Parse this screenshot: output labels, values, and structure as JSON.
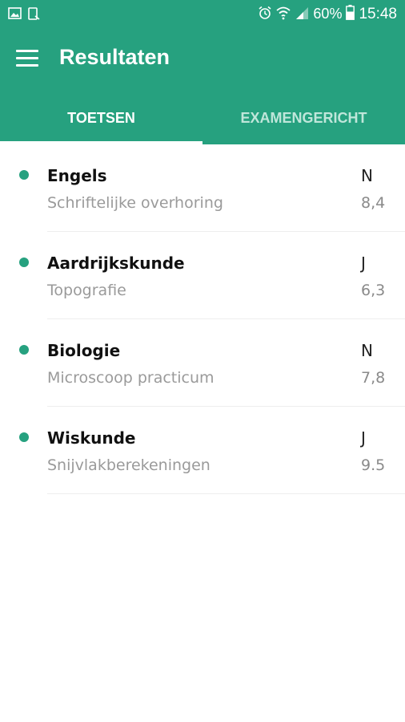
{
  "status_bar": {
    "left_icons": [
      "image-icon",
      "phone-outline-icon"
    ],
    "right_icons": [
      "alarm-icon",
      "wifi-icon",
      "signal-icon",
      "battery-icon"
    ],
    "battery_percent": "60%",
    "time": "15:48"
  },
  "toolbar": {
    "menu_icon": "hamburger-menu-icon",
    "title": "Resultaten"
  },
  "tabs": [
    {
      "label": "TOETSEN",
      "active": true
    },
    {
      "label": "EXAMENGERICHT",
      "active": false
    }
  ],
  "results": [
    {
      "subject": "Engels",
      "description": "Schriftelijke overhoring",
      "flag": "N",
      "grade": "8,4"
    },
    {
      "subject": "Aardrijkskunde",
      "description": "Topografie",
      "flag": "J",
      "grade": "6,3"
    },
    {
      "subject": "Biologie",
      "description": "Microscoop practicum",
      "flag": "N",
      "grade": "7,8"
    },
    {
      "subject": "Wiskunde",
      "description": "Snijvlakberekeningen",
      "flag": "J",
      "grade": "9.5"
    }
  ],
  "colors": {
    "primary": "#26a17f",
    "bullet": "#26a17f",
    "inactive_tab_text": "#bfe6da"
  }
}
